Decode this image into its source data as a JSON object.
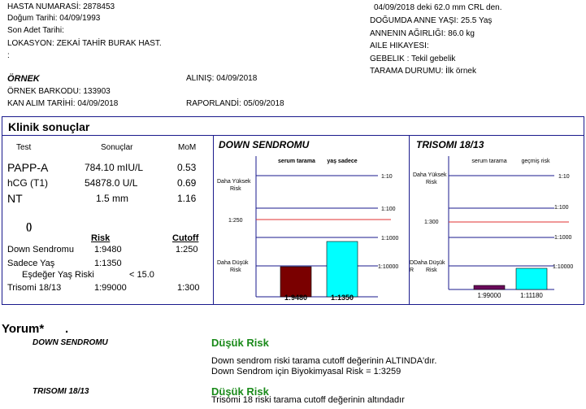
{
  "patient": {
    "id_line": "HASTA NUMARASİ: 2878453",
    "dob_line": "Doğum Tarihi: 04/09/1993",
    "lmp_line": "Son Adet Tarihi:",
    "location_line": "LOKASYON: ZEKAİ TAHİR BURAK HAST.",
    "colon_line": ":"
  },
  "pregnancy": {
    "crl_line": "04/09/2018 deki 62.0 mm CRL den.",
    "age_line": "DOĞUMDA ANNE YAŞI: 25.5 Yaş",
    "weight_line": "ANNENIN AĞIRLIĞI: 86.0 kg",
    "family_line": "AILE HIKAYESI:",
    "gestation_line": "GEBELIK : Tekil gebelik",
    "screening_line": "TARAMA DURUMU: İlk örnek"
  },
  "sample": {
    "heading": "ÖRNEK",
    "barcode_line": "ÖRNEK BARKODU: 133903",
    "collection_line": "KAN ALIM TARİHİ: 04/09/2018",
    "received_line": "ALINIŞ: 04/09/2018",
    "reported_line": "RAPORLANDİ: 05/09/2018"
  },
  "clinical": {
    "title": "Klinik sonuçlar",
    "headers": {
      "test": "Test",
      "result": "Sonuçlar",
      "mom": "MoM"
    },
    "rows": [
      {
        "name": "PAPP-A",
        "result": "784.10 mIU/L",
        "mom": "0.53"
      },
      {
        "name": "hCG (T1)",
        "result": "54878.0 U/L",
        "mom": "0.69"
      },
      {
        "name": "NT",
        "result": "1.5 mm",
        "mom": "1.16"
      }
    ],
    "paren": "()",
    "risk_header": "Risk",
    "cutoff_header": "Cutoff",
    "risk_rows": [
      {
        "name": "Down Sendromu",
        "risk": "1:9480",
        "cutoff": "1:250"
      },
      {
        "name": "Sadece Yaş",
        "risk": "1:1350",
        "cutoff": ""
      },
      {
        "name": "Eşdeğer Yaş Riski",
        "risk": "< 15.0",
        "cutoff": ""
      },
      {
        "name": "Trisomi 18/13",
        "risk": "1:99000",
        "cutoff": "1:300"
      }
    ]
  },
  "chart_data": [
    {
      "type": "bar",
      "title": "DOWN SENDROMU",
      "categories": [
        "serum tarama",
        "yaş sadece"
      ],
      "values": [
        "1:9480",
        "1:1350"
      ],
      "bar_labels": [
        "1:9480",
        "1:1350"
      ],
      "colors": [
        "#7a0000",
        "#00ffff"
      ],
      "scale_labels": [
        "1:10",
        "1:100",
        "1:1000",
        "1:10000"
      ],
      "cutoff_label": "1:250",
      "high_label": "Daha Yüksek Risk",
      "low_label": "Daha Düşük Risk"
    },
    {
      "type": "bar",
      "title": "TRISOMI 18/13",
      "categories": [
        "serum tarama",
        "geçmiş risk"
      ],
      "values": [
        "1:99000",
        "1:11180"
      ],
      "bar_labels": [
        "1:99000",
        "1:11180"
      ],
      "colors": [
        "#6a0a5a",
        "#00ffff"
      ],
      "scale_labels": [
        "1:10",
        "1:100",
        "1:1000",
        "1:10000"
      ],
      "cutoff_label": "1:300",
      "high_label": "Daha Yüksek Risk",
      "low_label": "Daha Düşük Risk",
      "low_prefix": "D",
      "low_prefix2": "R"
    }
  ],
  "comments": {
    "heading": "Yorum*",
    "dot": ".",
    "down_label": "DOWN SENDROMU",
    "down_risk": "Düşük Risk",
    "down_text1": "Down sendrom riski tarama cutoff değerinin ALTINDA'dır.",
    "down_text2": "Down Sendrom için Biyokimyasal Risk = 1:3259",
    "tri_label": "TRISOMI 18/13",
    "tri_risk": "Düşük Risk",
    "tri_text1": "Trisomi 18 riski tarama cutoff değerinin altındadır"
  },
  "colors": {
    "border": "#1a1a8c",
    "line": "#1a1a8c",
    "cutoff": "#e03030",
    "green": "#1a8a1a"
  }
}
